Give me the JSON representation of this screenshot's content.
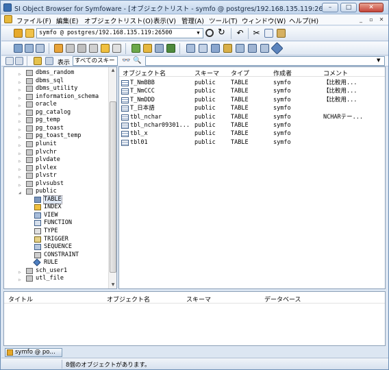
{
  "window": {
    "title": "SI Object Browser for Symfoware - [オブジェクトリスト - symfo @ postgres/192.168.135.119:26500]",
    "controls": {
      "minimize": "–",
      "maximize": "□",
      "close": "✕"
    }
  },
  "menubar": {
    "items": [
      "ファイル(F)",
      "編集(E)",
      "オブジェクトリスト(O)",
      "表示(V)",
      "管理(A)",
      "ツール(T)",
      "ウィンドウ(W)",
      "ヘルプ(H)"
    ],
    "mdi_controls": {
      "minimize": "_",
      "restore": "▫",
      "close": "✕"
    }
  },
  "toolbar": {
    "connection": "symfo @ postgres/192.168.135.119:26500"
  },
  "filterbar": {
    "display_label": "表示",
    "schema_filter": "すべてのスキー",
    "search_value": ""
  },
  "tree": {
    "items": [
      {
        "label": "dbms_random",
        "level": 1,
        "expander": "▷",
        "icon": "schema-icon"
      },
      {
        "label": "dbms_sql",
        "level": 1,
        "expander": "▷",
        "icon": "schema-icon"
      },
      {
        "label": "dbms_utility",
        "level": 1,
        "expander": "▷",
        "icon": "schema-icon"
      },
      {
        "label": "information_schema",
        "level": 1,
        "expander": "▷",
        "icon": "schema-icon"
      },
      {
        "label": "oracle",
        "level": 1,
        "expander": "▷",
        "icon": "schema-icon"
      },
      {
        "label": "pg_catalog",
        "level": 1,
        "expander": "▷",
        "icon": "schema-icon"
      },
      {
        "label": "pg_temp",
        "level": 1,
        "expander": "▷",
        "icon": "schema-icon"
      },
      {
        "label": "pg_toast",
        "level": 1,
        "expander": "▷",
        "icon": "schema-icon"
      },
      {
        "label": "pg_toast_temp",
        "level": 1,
        "expander": "▷",
        "icon": "schema-icon"
      },
      {
        "label": "plunit",
        "level": 1,
        "expander": "▷",
        "icon": "schema-icon"
      },
      {
        "label": "plvchr",
        "level": 1,
        "expander": "▷",
        "icon": "schema-icon"
      },
      {
        "label": "plvdate",
        "level": 1,
        "expander": "▷",
        "icon": "schema-icon"
      },
      {
        "label": "plvlex",
        "level": 1,
        "expander": "▷",
        "icon": "schema-icon"
      },
      {
        "label": "plvstr",
        "level": 1,
        "expander": "▷",
        "icon": "schema-icon"
      },
      {
        "label": "plvsubst",
        "level": 1,
        "expander": "▷",
        "icon": "schema-icon"
      },
      {
        "label": "public",
        "level": 1,
        "expander": "◢",
        "icon": "schema-icon"
      },
      {
        "label": "TABLE",
        "level": 2,
        "expander": "",
        "icon": "table-icon",
        "selected": true
      },
      {
        "label": "INDEX",
        "level": 2,
        "expander": "",
        "icon": "index-icon"
      },
      {
        "label": "VIEW",
        "level": 2,
        "expander": "",
        "icon": "view-icon"
      },
      {
        "label": "FUNCTION",
        "level": 2,
        "expander": "",
        "icon": "function-icon"
      },
      {
        "label": "TYPE",
        "level": 2,
        "expander": "",
        "icon": "type-icon"
      },
      {
        "label": "TRIGGER",
        "level": 2,
        "expander": "",
        "icon": "trigger-icon"
      },
      {
        "label": "SEQUENCE",
        "level": 2,
        "expander": "",
        "icon": "sequence-icon"
      },
      {
        "label": "CONSTRAINT",
        "level": 2,
        "expander": "",
        "icon": "constraint-icon"
      },
      {
        "label": "RULE",
        "level": 2,
        "expander": "",
        "icon": "rule-icon"
      },
      {
        "label": "sch_user1",
        "level": 1,
        "expander": "▷",
        "icon": "schema-icon"
      },
      {
        "label": "utl_file",
        "level": 1,
        "expander": "▷",
        "icon": "schema-icon"
      }
    ]
  },
  "object_list": {
    "columns": [
      "オブジェクト名",
      "スキーマ",
      "タイプ",
      "作成者",
      "コメント"
    ],
    "rows": [
      [
        "T_NmBBB",
        "public",
        "TABLE",
        "symfo",
        "【比較用..."
      ],
      [
        "T_NmCCC",
        "public",
        "TABLE",
        "symfo",
        "【比較用..."
      ],
      [
        "T_NmDDD",
        "public",
        "TABLE",
        "symfo",
        "【比較用..."
      ],
      [
        "T_日本語",
        "public",
        "TABLE",
        "symfo",
        ""
      ],
      [
        "tbl_nchar",
        "public",
        "TABLE",
        "symfo",
        "NCHARテー..."
      ],
      [
        "tbl_nchar09301...",
        "public",
        "TABLE",
        "symfo",
        ""
      ],
      [
        "tbl_x",
        "public",
        "TABLE",
        "symfo",
        ""
      ],
      [
        "tbl01",
        "public",
        "TABLE",
        "symfo",
        ""
      ]
    ]
  },
  "bottom_list": {
    "columns": [
      "タイトル",
      "オブジェクト名",
      "スキーマ",
      "データベース"
    ]
  },
  "taskbar": {
    "item": "symfo @ po…"
  },
  "status": {
    "text": "8個のオブジェクトがあります。"
  }
}
